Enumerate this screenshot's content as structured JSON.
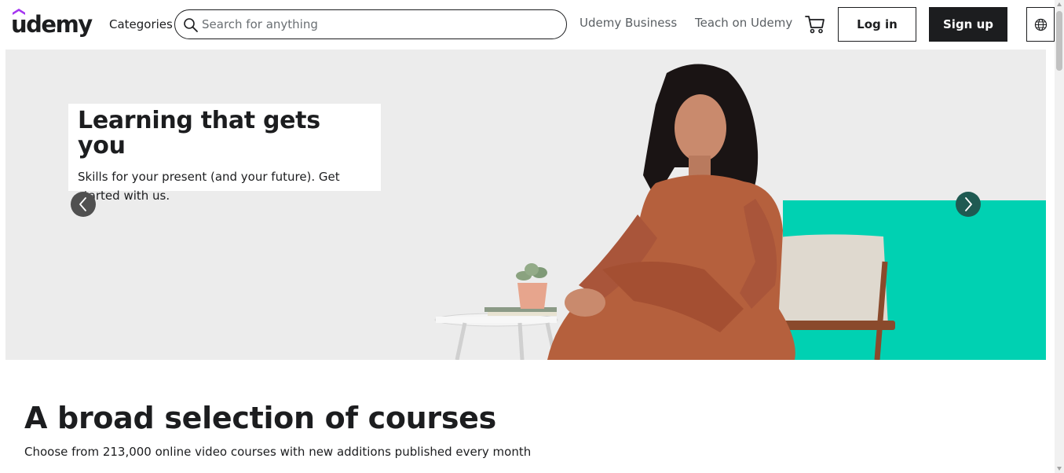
{
  "header": {
    "logo_text": "udemy",
    "categories_label": "Categories",
    "search_placeholder": "Search for anything",
    "nav_business": "Udemy Business",
    "nav_teach": "Teach on Udemy",
    "login_label": "Log in",
    "signup_label": "Sign up"
  },
  "hero": {
    "title": "Learning that gets you",
    "subtitle": "Skills for your present (and your future). Get started with us."
  },
  "section": {
    "title": "A broad selection of courses",
    "subtitle": "Choose from 213,000 online video courses with new additions published every month"
  },
  "colors": {
    "brand_purple": "#a435f0",
    "ink": "#1c1d1f",
    "hero_bg": "#ececec",
    "teal": "#00d1b2"
  }
}
